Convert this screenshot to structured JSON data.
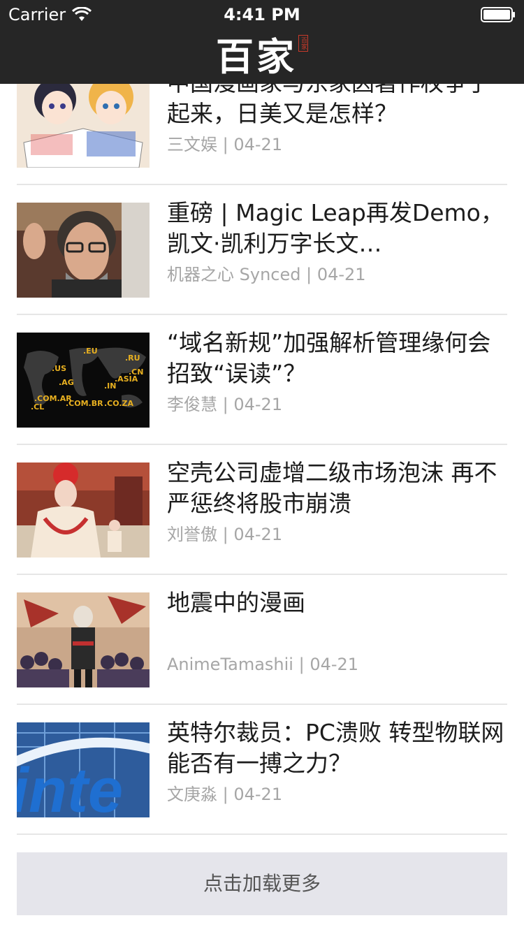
{
  "status": {
    "carrier": "Carrier",
    "time": "4:41 PM"
  },
  "brand": {
    "name": "百家",
    "seal": "百家"
  },
  "articles": [
    {
      "title": "中国漫画家与东家因著作权争了起来，日美又是怎样？",
      "author": "三文娱",
      "date": "04-21",
      "thumb": "anime-readers"
    },
    {
      "title": "重磅 | Magic Leap再发Demo，凯文·凯利万字长文…",
      "author": "机器之心 Synced",
      "date": "04-21",
      "thumb": "man-with-glasses"
    },
    {
      "title": "“域名新规”加强解析管理缘何会招致“误读”？",
      "author": "李俊慧",
      "date": "04-21",
      "thumb": "world-map-domains"
    },
    {
      "title": "空壳公司虚增二级市场泡沫 再不严惩终将股市崩溃",
      "author": "刘誉傲",
      "date": "04-21",
      "thumb": "palace-drama"
    },
    {
      "title": "地震中的漫画",
      "author": "AnimeTamashii",
      "date": "04-21",
      "thumb": "anime-crowd"
    },
    {
      "title": "英特尔裁员：PC溃败 转型物联网能否有一搏之力？",
      "author": "文庚淼",
      "date": "04-21",
      "thumb": "intel-logo"
    }
  ],
  "meta_separator": " | ",
  "load_more": "点击加载更多"
}
